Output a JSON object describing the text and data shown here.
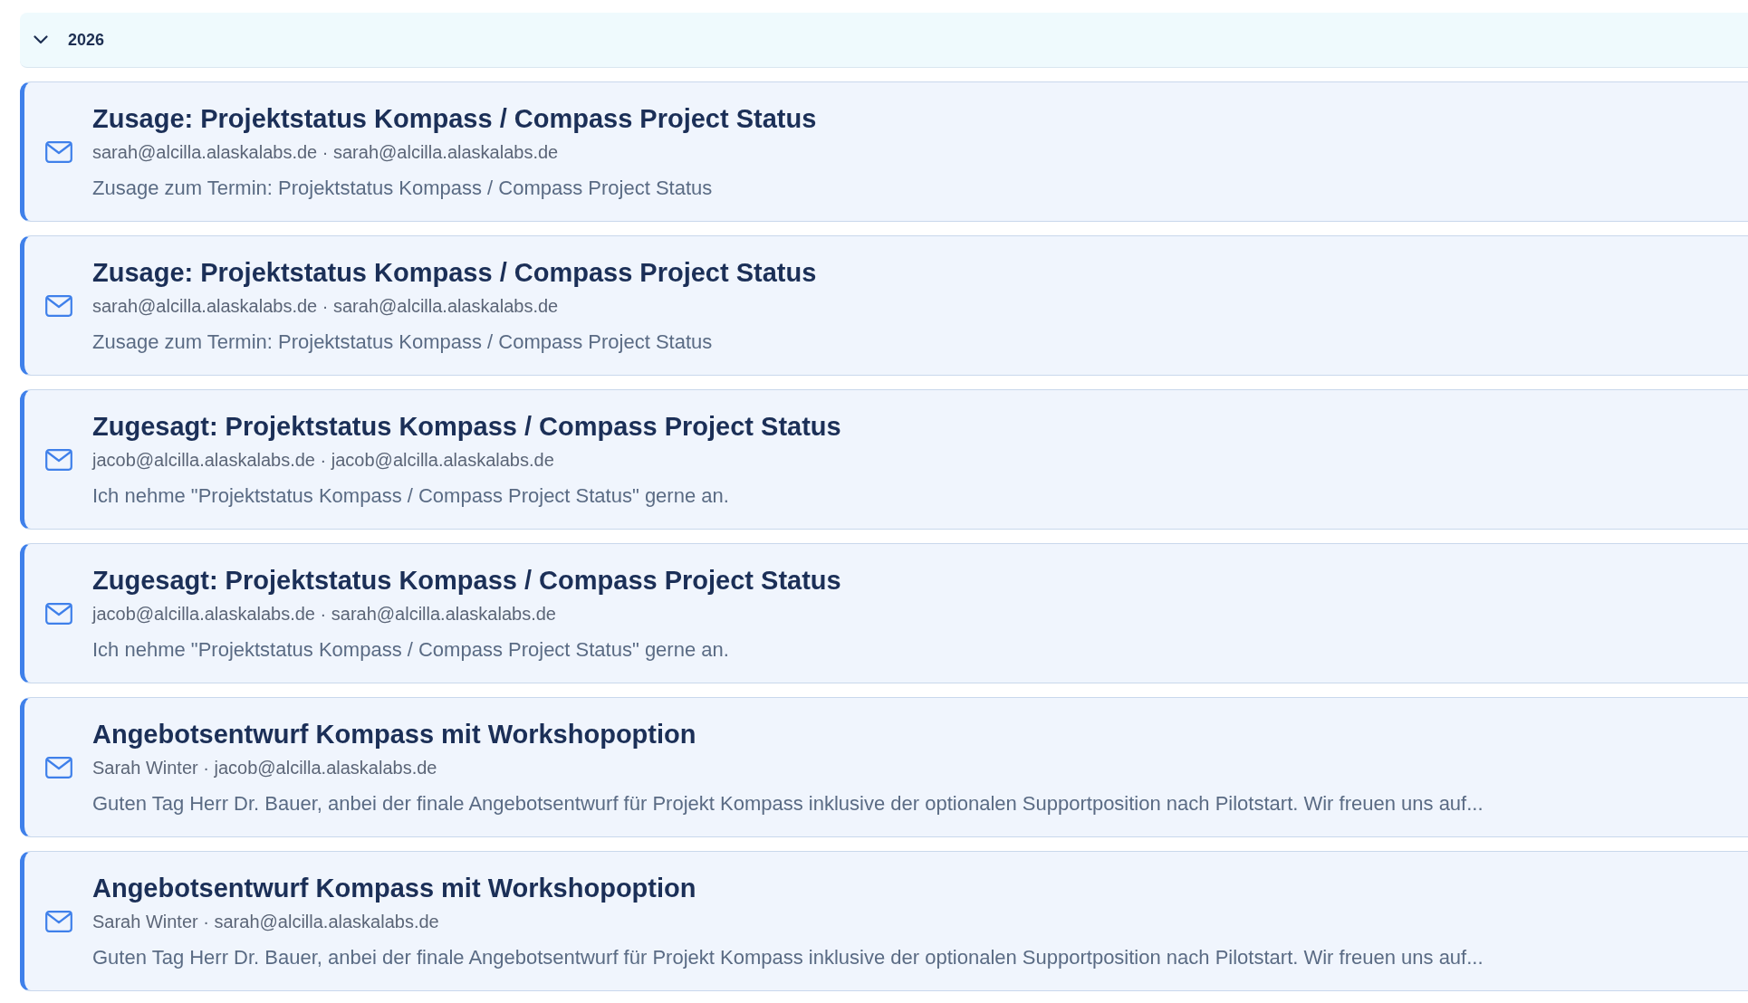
{
  "group": {
    "label": "2026",
    "expanded": true
  },
  "messages": [
    {
      "subject": "Zusage: Projektstatus Kompass / Compass Project Status",
      "addresses": "sarah@alcilla.alaskalabs.de · sarah@alcilla.alaskalabs.de",
      "preview": "Zusage zum Termin: Projektstatus Kompass / Compass Project Status"
    },
    {
      "subject": "Zusage: Projektstatus Kompass / Compass Project Status",
      "addresses": "sarah@alcilla.alaskalabs.de · sarah@alcilla.alaskalabs.de",
      "preview": "Zusage zum Termin: Projektstatus Kompass / Compass Project Status"
    },
    {
      "subject": "Zugesagt: Projektstatus Kompass / Compass Project Status",
      "addresses": "jacob@alcilla.alaskalabs.de · jacob@alcilla.alaskalabs.de",
      "preview": "Ich nehme \"Projektstatus Kompass / Compass Project Status\" gerne an."
    },
    {
      "subject": "Zugesagt: Projektstatus Kompass / Compass Project Status",
      "addresses": "jacob@alcilla.alaskalabs.de · sarah@alcilla.alaskalabs.de",
      "preview": "Ich nehme \"Projektstatus Kompass / Compass Project Status\" gerne an."
    },
    {
      "subject": "Angebotsentwurf Kompass mit Workshopoption",
      "addresses": "Sarah Winter · jacob@alcilla.alaskalabs.de",
      "preview": "Guten Tag Herr Dr. Bauer, anbei der finale Angebotsentwurf für Projekt Kompass inklusive der optionalen Supportposition nach Pilotstart. Wir freuen uns auf..."
    },
    {
      "subject": "Angebotsentwurf Kompass mit Workshopoption",
      "addresses": "Sarah Winter · sarah@alcilla.alaskalabs.de",
      "preview": "Guten Tag Herr Dr. Bauer, anbei der finale Angebotsentwurf für Projekt Kompass inklusive der optionalen Supportposition nach Pilotstart. Wir freuen uns auf..."
    }
  ]
}
